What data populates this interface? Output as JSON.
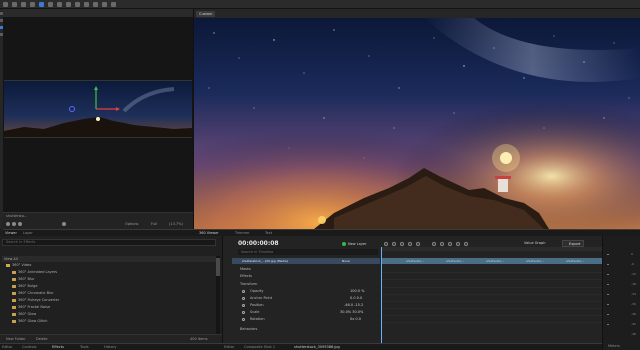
{
  "viewer": {
    "clip_name": "shuttersto...",
    "zoom": "(13.7%)",
    "options_label": "Options",
    "full_label": "Full"
  },
  "preview": {
    "tab_label": "Custom"
  },
  "bottom_tabs_left": [
    "Viewer",
    "Layer"
  ],
  "bottom_tabs_right": [
    "360 Viewer",
    "Trimmer",
    "Text"
  ],
  "effects": {
    "search_placeholder": "Search in Effects",
    "header": "View All",
    "folder": "360° Video",
    "items": [
      "360° Animated Layers",
      "360° Blur",
      "360° Bulge",
      "360° Chromatic Blur",
      "360° Fisheye Converter",
      "360° Fractal Noise",
      "360° Glow",
      "360° Glow Glitch"
    ],
    "new_folder_label": "New Folder",
    "delete_label": "Delete",
    "item_count": "400 items",
    "tabs": [
      "Editor",
      "Controls",
      "Effects",
      "Tools",
      "History"
    ]
  },
  "timeline": {
    "timecode": "00:00:00:08",
    "search_placeholder": "Search in Timeline",
    "new_layer_label": "New Layer",
    "value_graph_label": "Value Graph",
    "export_label": "Export",
    "layer_name": "shutterstock_...(00.jpg (Media)",
    "layer_blend": "None",
    "clip_label": "shuttersto...",
    "rows": [
      {
        "name": "Masks"
      },
      {
        "name": "Effects"
      },
      {
        "name": "Transform"
      },
      {
        "name": "Opacity",
        "value": "100.0 %"
      },
      {
        "name": "Anchor Point",
        "value": "0.0   0.0"
      },
      {
        "name": "Position",
        "value": "-46.0   -15.2"
      },
      {
        "name": "Scale",
        "value": "30.0%   30.0%"
      },
      {
        "name": "Rotation",
        "value": "0x   0.0"
      },
      {
        "name": "Behaviors"
      }
    ],
    "tabs": [
      "Editor",
      "Composite Shot 1",
      "shutterstock_3095386.jpg"
    ]
  },
  "meters": {
    "label": "Meters",
    "scale": [
      "0",
      "-6",
      "-12",
      "-18",
      "-24",
      "-30",
      "-36",
      "-42",
      "-48"
    ]
  },
  "colors": {
    "accent_blue": "#4a6e86",
    "playhead": "#6ab0ff",
    "new_layer_green": "#3bb54a",
    "folder_yellow": "#d6a64a"
  }
}
